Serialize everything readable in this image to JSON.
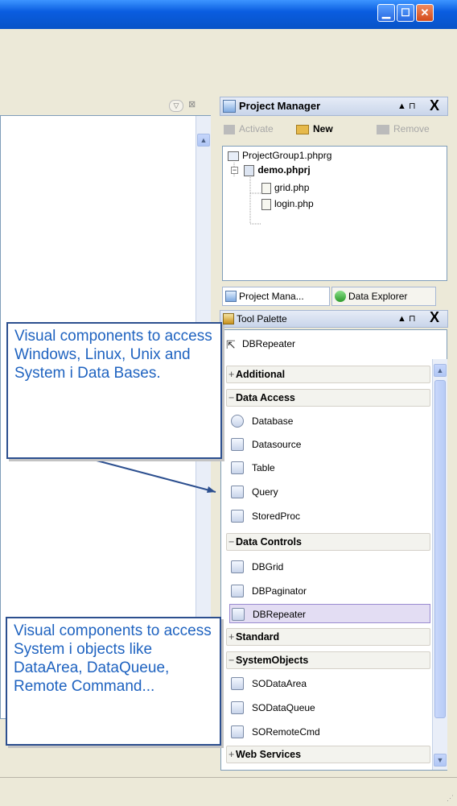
{
  "window": {
    "title_buttons": [
      {
        "icon": "minimize-icon"
      },
      {
        "icon": "maximize-icon"
      },
      {
        "icon": "close-icon"
      }
    ]
  },
  "project_manager": {
    "title": "Project Manager",
    "pin_glyph": "▲ ⊓",
    "close_glyph": "X",
    "toolbar": [
      {
        "label": "Activate",
        "enabled": false
      },
      {
        "label": "New",
        "enabled": true
      },
      {
        "label": "Remove",
        "enabled": false
      }
    ],
    "tree": [
      {
        "label": "ProjectGroup1.phprg",
        "bold": false,
        "level": 0
      },
      {
        "label": "demo.phprj",
        "bold": true,
        "level": 1
      },
      {
        "label": "grid.php",
        "bold": false,
        "level": 2
      },
      {
        "label": "login.php",
        "bold": false,
        "level": 2
      }
    ],
    "tabs": [
      {
        "label": "Project Mana...",
        "active": true
      },
      {
        "label": "Data Explorer",
        "active": false
      }
    ]
  },
  "tool_palette": {
    "title": "Tool Palette",
    "search_value": "DBRepeater",
    "categories": [
      {
        "label": "Additional",
        "expanded": false,
        "items": []
      },
      {
        "label": "Data Access",
        "expanded": true,
        "items": [
          {
            "label": "Database",
            "icon": "database-icon"
          },
          {
            "label": "Datasource",
            "icon": "datasource-icon"
          },
          {
            "label": "Table",
            "icon": "table-icon"
          },
          {
            "label": "Query",
            "icon": "query-icon"
          },
          {
            "label": "StoredProc",
            "icon": "storedproc-icon"
          }
        ]
      },
      {
        "label": "Data Controls",
        "expanded": true,
        "items": [
          {
            "label": "DBGrid",
            "icon": "dbgrid-icon"
          },
          {
            "label": "DBPaginator",
            "icon": "dbpaginator-icon"
          },
          {
            "label": "DBRepeater",
            "icon": "dbrepeater-icon",
            "selected": true
          }
        ]
      },
      {
        "label": "Standard",
        "expanded": false,
        "items": []
      },
      {
        "label": "SystemObjects",
        "expanded": true,
        "items": [
          {
            "label": "SODataArea",
            "icon": "sodataarea-icon"
          },
          {
            "label": "SODataQueue",
            "icon": "sodataqueue-icon"
          },
          {
            "label": "SORemoteCmd",
            "icon": "soremotecmd-icon"
          }
        ]
      },
      {
        "label": "Web Services",
        "expanded": false,
        "items": []
      }
    ]
  },
  "callouts": [
    {
      "text": "Visual  components to access Windows, Linux, Unix and System i Data Bases."
    },
    {
      "text": "Visual components to access System i objects like DataArea, DataQueue, Remote Command..."
    }
  ],
  "colors": {
    "callout_text": "#1f63c0",
    "callout_border": "#2c4f8f",
    "selection": "#e3ddf3"
  }
}
